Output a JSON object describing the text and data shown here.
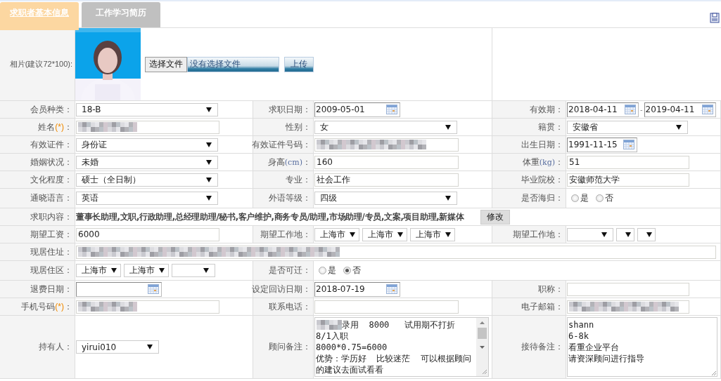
{
  "tabs": [
    {
      "label": "求职者基本信息",
      "selected": true
    },
    {
      "label": "工作学习简历",
      "selected": false
    }
  ],
  "photo": {
    "label": "相片(建议72*100):",
    "kind": "picture",
    "choose_button": "选择文件",
    "file_status": "没有选择文件",
    "upload_button": "上传"
  },
  "rows": [
    {
      "cells": [
        {
          "label": "会员种类：",
          "field": {
            "kind": "select",
            "value": "18-B"
          }
        },
        {
          "label": "求职日期：",
          "field": {
            "kind": "date",
            "value": "2009-05-01"
          }
        },
        {
          "label": "有效期：",
          "field": {
            "kind": "date_range",
            "from": "2018-04-11",
            "separator": "-",
            "to": "2019-04-11"
          }
        }
      ]
    },
    {
      "cells": [
        {
          "label": "姓名",
          "note": "(*)",
          "required": true,
          "suffix": "：",
          "field": {
            "kind": "redacted"
          }
        },
        {
          "label": "性别：",
          "field": {
            "kind": "select",
            "value": "女"
          }
        },
        {
          "label": "籍贯：",
          "field": {
            "kind": "select",
            "value": "安徽省"
          }
        }
      ]
    },
    {
      "cells": [
        {
          "label": "有效证件：",
          "field": {
            "kind": "select",
            "value": "身份证"
          }
        },
        {
          "label": "有效证件号码：",
          "field": {
            "kind": "redacted"
          }
        },
        {
          "label": "出生日期：",
          "field": {
            "kind": "date",
            "value": "1991-11-15"
          }
        }
      ]
    },
    {
      "cells": [
        {
          "label": "婚姻状况：",
          "field": {
            "kind": "select",
            "value": "未婚"
          }
        },
        {
          "label": "身高",
          "note": "(cm)",
          "required": false,
          "suffix": "：",
          "field": {
            "kind": "input",
            "value": "160"
          }
        },
        {
          "label": "体重",
          "note": "(kg)",
          "required": false,
          "suffix": "：",
          "field": {
            "kind": "input",
            "value": "51"
          }
        }
      ]
    },
    {
      "cells": [
        {
          "label": "文化程度：",
          "field": {
            "kind": "select",
            "value": "硕士（全日制）"
          }
        },
        {
          "label": "专业：",
          "field": {
            "kind": "input",
            "value": "社会工作"
          }
        },
        {
          "label": "毕业院校：",
          "field": {
            "kind": "input",
            "value": "安徽师范大学"
          }
        }
      ]
    },
    {
      "cells": [
        {
          "label": "通晓语言：",
          "field": {
            "kind": "select",
            "value": "英语"
          }
        },
        {
          "label": "外语等级：",
          "field": {
            "kind": "select",
            "value": "四级"
          }
        },
        {
          "label": "是否海归：",
          "field": {
            "kind": "radios",
            "options": [
              {
                "label": "是",
                "selected": false
              },
              {
                "label": "否",
                "selected": false
              }
            ]
          }
        }
      ]
    },
    {
      "cells": [
        {
          "label": "求职内容：",
          "field": {
            "kind": "text_button",
            "value": "董事长助理,文职,行政助理,总经理助理/秘书,客户维护,商务专员/助理,市场助理/专员,文案,项目助理,新媒体",
            "button": "修改"
          }
        }
      ]
    },
    {
      "cells": [
        {
          "label": "期望工资：",
          "field": {
            "kind": "input",
            "value": "6000"
          }
        },
        {
          "label": "期望工作地：",
          "field": {
            "kind": "selects",
            "options": [
              {
                "kind": "filled",
                "value": "上海市"
              },
              {
                "kind": "filled",
                "value": "上海市"
              },
              {
                "kind": "filled",
                "value": "上海市"
              }
            ]
          }
        },
        {
          "label": "期望工作地：",
          "field": {
            "kind": "selects",
            "options": [
              {
                "kind": "blank"
              },
              {
                "kind": "blank"
              },
              {
                "kind": "blank"
              }
            ]
          }
        }
      ]
    },
    {
      "cells": [
        {
          "label": "现居住址：",
          "field": {
            "kind": "redacted"
          }
        }
      ]
    },
    {
      "cells": [
        {
          "label": "现居住区：",
          "field": {
            "kind": "selects",
            "options": [
              {
                "kind": "filled",
                "value": "上海市"
              },
              {
                "kind": "filled",
                "value": "上海市"
              },
              {
                "kind": "blank"
              }
            ]
          }
        },
        {
          "label": "是否可迁：",
          "field": {
            "kind": "radios",
            "options": [
              {
                "label": "是",
                "selected": false
              },
              {
                "label": "否",
                "selected": true
              }
            ]
          }
        }
      ]
    },
    {
      "cells": [
        {
          "label": "退费日期：",
          "field": {
            "kind": "date"
          }
        },
        {
          "label": "设定回访日期：",
          "field": {
            "kind": "date",
            "value": "2018-07-19"
          }
        },
        {
          "label": "职称：",
          "field": {
            "kind": "input"
          }
        }
      ]
    },
    {
      "cells": [
        {
          "label": "手机号码",
          "note": "(*)",
          "required": true,
          "suffix": "：",
          "field": {
            "kind": "redacted"
          }
        },
        {
          "label": "联系电话：",
          "field": {
            "kind": "input"
          }
        },
        {
          "label": "电子邮箱：",
          "field": {
            "kind": "redacted"
          }
        }
      ]
    },
    {
      "cells": [
        {
          "label": "持有人：",
          "field": {
            "kind": "select",
            "value": "yirui010"
          }
        },
        {
          "label": "顾问备注：",
          "field": {
            "kind": "scrolling_textarea",
            "redacted_prefix": true,
            "lines": [
              "录用  8000   试用期不打折",
              "8/1入职",
              "8000*0.75=6000",
              "优势：学历好  比较迷茫  可以根据顾问的建议去面试看看"
            ]
          }
        },
        {
          "label": "接待备注：",
          "field": {
            "kind": "textarea",
            "redacted_prefix": false,
            "lines": [
              "shann",
              "6-8k",
              "看重企业平台",
              "请资深顾问进行指导"
            ]
          }
        }
      ]
    }
  ]
}
